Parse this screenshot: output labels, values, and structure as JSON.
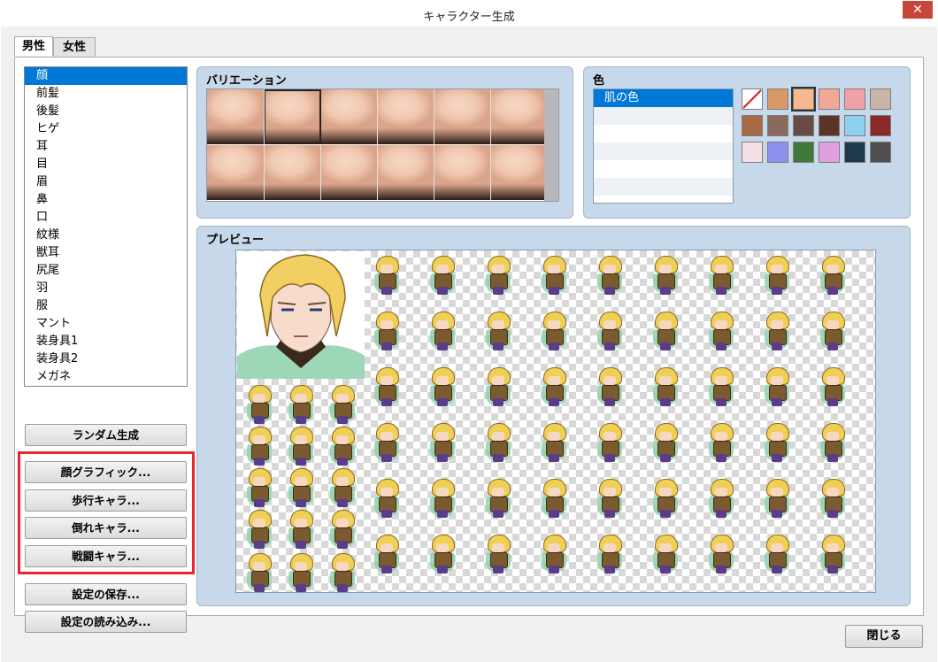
{
  "window": {
    "title": "キャラクター生成",
    "close_glyph": "✕"
  },
  "tabs": [
    {
      "label": "男性",
      "active": true
    },
    {
      "label": "女性",
      "active": false
    }
  ],
  "parts": [
    "顔",
    "前髪",
    "後髪",
    "ヒゲ",
    "耳",
    "目",
    "眉",
    "鼻",
    "口",
    "紋様",
    "獣耳",
    "尻尾",
    "羽",
    "服",
    "マント",
    "装身具1",
    "装身具2",
    "メガネ"
  ],
  "selected_part": "顔",
  "buttons": {
    "random": "ランダム生成",
    "face_graphic": "顔グラフィック...",
    "walk": "歩行キャラ...",
    "down": "倒れキャラ...",
    "battle": "戦闘キャラ...",
    "save": "設定の保存...",
    "load": "設定の読み込み...",
    "close": "閉じる"
  },
  "variation": {
    "title": "バリエーション",
    "selected_index": 1
  },
  "color": {
    "title": "色",
    "list": [
      "肌の色",
      "",
      "",
      "",
      "",
      ""
    ],
    "swatches": [
      "#ffffff",
      "#d99868",
      "#f4b98e",
      "#f2a896",
      "#f0a0a8",
      "#c9b5a6",
      "#a86a45",
      "#8a6a5f",
      "#6a4a44",
      "#5a3426",
      "#8fd0ef",
      "#8a2a2a",
      "#f4e0e6",
      "#8f8ff0",
      "#3f7a3a",
      "#e0a0e0",
      "#1e3a4a",
      "#505050"
    ],
    "selected_swatch": 2
  },
  "preview": {
    "title": "プレビュー"
  }
}
